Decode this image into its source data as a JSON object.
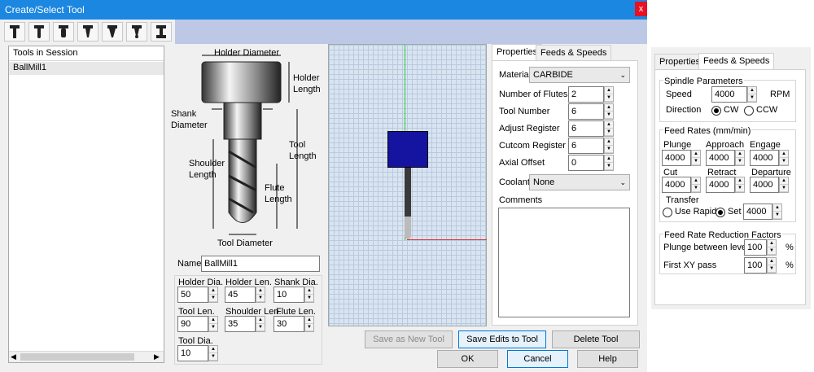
{
  "window": {
    "title": "Create/Select Tool",
    "close_glyph": "x"
  },
  "toolbar": {
    "icons": [
      "endmill-icon",
      "ballmill-icon",
      "bullnose-icon",
      "chamfer-icon",
      "taper-icon",
      "taper-ball-icon",
      "tslot-icon"
    ]
  },
  "tree": {
    "header": "Tools in Session",
    "items": [
      "BallMill1"
    ]
  },
  "diagram": {
    "holder_diameter": "Holder Diameter",
    "holder_length": "Holder\nLength",
    "shank_diameter": "Shank\nDiameter",
    "tool_length": "Tool\nLength",
    "shoulder_length": "Shoulder\nLength",
    "flute_length": "Flute\nLength",
    "tool_diameter": "Tool Diameter"
  },
  "params": {
    "name_label": "Name",
    "name_value": "BallMill1",
    "holder_dia_label": "Holder Dia.",
    "holder_dia": "50",
    "holder_len_label": "Holder Len.",
    "holder_len": "45",
    "shank_dia_label": "Shank Dia.",
    "shank_dia": "10",
    "tool_len_label": "Tool Len.",
    "tool_len": "90",
    "shoulder_len_label": "Shoulder Len.",
    "shoulder_len": "35",
    "flute_len_label": "Flute Len.",
    "flute_len": "30",
    "tool_dia_label": "Tool Dia.",
    "tool_dia": "10"
  },
  "tabs": {
    "properties": "Properties",
    "feeds": "Feeds & Speeds"
  },
  "properties": {
    "material_label": "Material",
    "material": "CARBIDE",
    "flutes_label": "Number of Flutes",
    "flutes": "2",
    "tool_number_label": "Tool Number",
    "tool_number": "6",
    "adjust_label": "Adjust Register",
    "adjust": "6",
    "cutcom_label": "Cutcom Register",
    "cutcom": "6",
    "axial_label": "Axial Offset",
    "axial": "0",
    "coolant_label": "Coolant",
    "coolant": "None",
    "comments_label": "Comments"
  },
  "buttons": {
    "save_new": "Save as New Tool",
    "save_edits": "Save Edits to Tool",
    "delete": "Delete Tool",
    "ok": "OK",
    "cancel": "Cancel",
    "help": "Help"
  },
  "feeds": {
    "spindle_group": "Spindle Parameters",
    "speed_label": "Speed",
    "speed": "4000",
    "rpm": "RPM",
    "direction_label": "Direction",
    "cw": "CW",
    "ccw": "CCW",
    "feed_group": "Feed Rates (mm/min)",
    "plunge_label": "Plunge",
    "plunge": "4000",
    "approach_label": "Approach",
    "approach": "4000",
    "engage_label": "Engage",
    "engage": "4000",
    "cut_label": "Cut",
    "cut": "4000",
    "retract_label": "Retract",
    "retract": "4000",
    "departure_label": "Departure",
    "departure": "4000",
    "transfer_label": "Transfer",
    "use_rapid": "Use Rapid",
    "set": "Set",
    "set_value": "4000",
    "reduction_group": "Feed Rate Reduction Factors",
    "plunge_levels_label": "Plunge between levels",
    "plunge_levels": "100",
    "first_xy_label": "First XY pass",
    "first_xy": "100",
    "pct": "%"
  }
}
